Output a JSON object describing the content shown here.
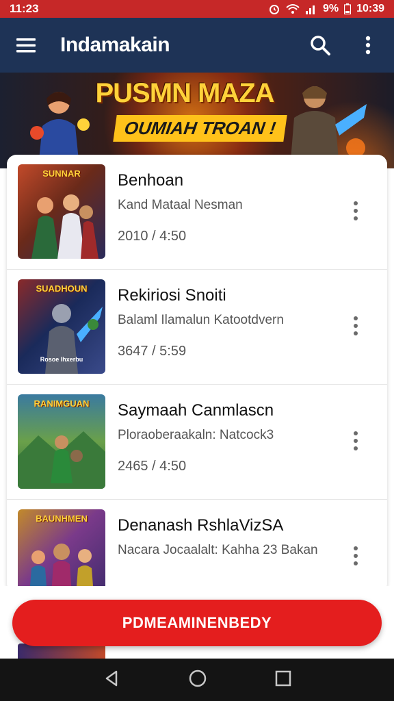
{
  "status_bar": {
    "time_left": "11:23",
    "battery": "9%",
    "time_right": "10:39"
  },
  "app_bar": {
    "title": "Indamakain"
  },
  "banner": {
    "title": "PUSMN MAZA",
    "subtitle": "OUMIAH TROAN !"
  },
  "list": [
    {
      "title": "Benhoan",
      "subtitle": "Kand Mataal Nesman",
      "time": "2010 / 4:50",
      "thumb_title": "SUNNAR",
      "thumb_colors": [
        "#6a2a1a",
        "#c24a2a",
        "#2a2a5a"
      ]
    },
    {
      "title": "Rekiriosi Snoiti",
      "subtitle": "Balaml Ilamalun Katootdvern",
      "time": "3647 / 5:59",
      "thumb_title": "SUADHOUN",
      "thumb_sub": "Rosoe Ihxerbu",
      "thumb_colors": [
        "#1a2a5a",
        "#3a4a8a",
        "#8a2a2a"
      ]
    },
    {
      "title": "Saymaah Canmlascn",
      "subtitle": "Ploraoberaakaln: Natcock3",
      "time": "2465 / 4:50",
      "thumb_title": "RANIMGUAN",
      "thumb_colors": [
        "#2a6a3a",
        "#6aa04a",
        "#3a7aa0"
      ]
    },
    {
      "title": "Denanash RshlaVizSA",
      "subtitle": "Nacara Jocaalalt: Kahha 23 Bakan",
      "time": "",
      "thumb_title": "BAUNHMEN",
      "thumb_colors": [
        "#3a2a6a",
        "#7a3a8a",
        "#c28a2a"
      ]
    }
  ],
  "cta": {
    "label": "PDMEAMINENBEDY"
  }
}
